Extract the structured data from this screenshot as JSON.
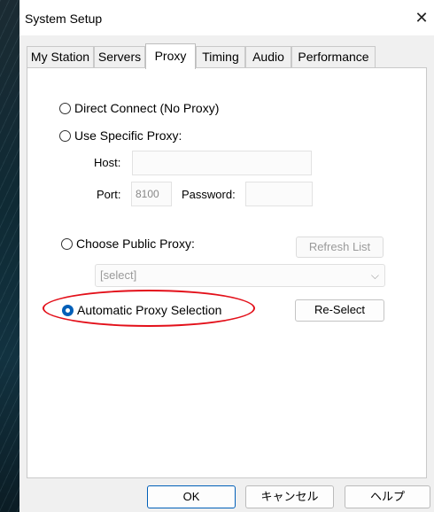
{
  "window": {
    "title": "System Setup"
  },
  "tabs": [
    {
      "label": "My Station",
      "active": false
    },
    {
      "label": "Servers",
      "active": false
    },
    {
      "label": "Proxy",
      "active": true
    },
    {
      "label": "Timing",
      "active": false
    },
    {
      "label": "Audio",
      "active": false
    },
    {
      "label": "Performance",
      "active": false
    }
  ],
  "proxy": {
    "direct": {
      "label": "Direct Connect (No Proxy)",
      "checked": false
    },
    "specific": {
      "label": "Use Specific Proxy:",
      "checked": false,
      "host_label": "Host:",
      "host_value": "",
      "port_label": "Port:",
      "port_value": "8100",
      "password_label": "Password:",
      "password_value": ""
    },
    "public": {
      "label": "Choose Public Proxy:",
      "checked": false,
      "refresh_label": "Refresh List",
      "select_value": "[select]"
    },
    "automatic": {
      "label": "Automatic Proxy Selection",
      "checked": true,
      "reselect_label": "Re-Select"
    }
  },
  "footer": {
    "ok_label": "OK",
    "cancel_label": "キャンセル",
    "help_label": "ヘルプ"
  },
  "colors": {
    "accent": "#005fb8",
    "annotation": "#e3101a"
  }
}
